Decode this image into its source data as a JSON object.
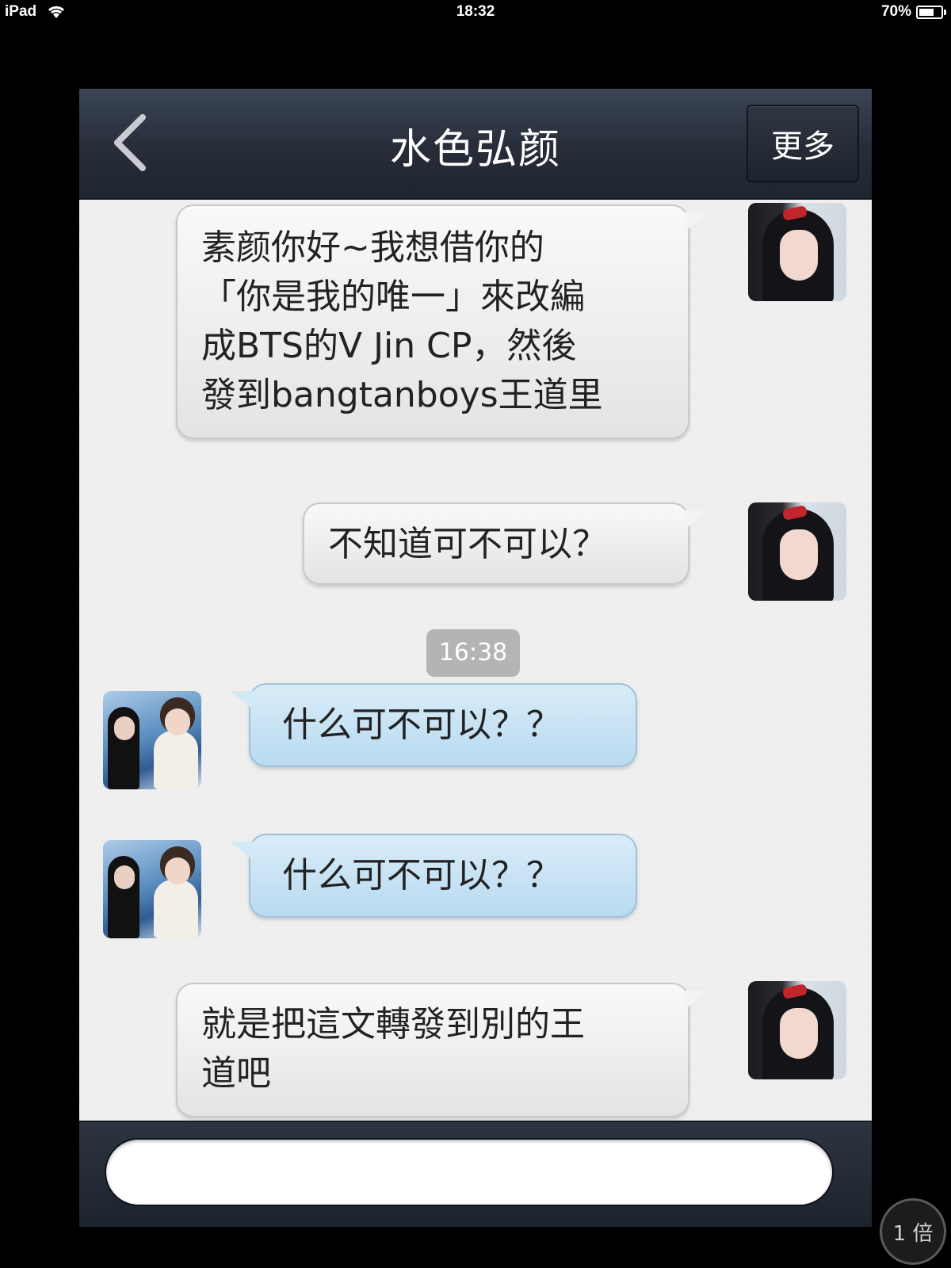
{
  "status_bar": {
    "device": "iPad",
    "time": "18:32",
    "battery": "70%",
    "battery_level": 0.7,
    "wifi_icon": "wifi-icon",
    "battery_icon": "battery-icon"
  },
  "nav": {
    "back_icon": "chevron-left-icon",
    "title": "水色弘颜",
    "more_label": "更多"
  },
  "messages": [
    {
      "side": "right",
      "avatar": "avatar-girl",
      "text": "素颜你好~我想借你的\n「你是我的唯一」來改編\n成BTS的V Jin CP，然後\n發到bangtanboys王道里"
    },
    {
      "side": "right",
      "avatar": "avatar-girl",
      "text": "不知道可不可以？"
    },
    {
      "side": "left",
      "avatar": "avatar-stage",
      "text": "什么可不可以？？"
    },
    {
      "side": "left",
      "avatar": "avatar-stage",
      "text": "什么可不可以？？"
    },
    {
      "side": "right",
      "avatar": "avatar-girl",
      "text": "就是把這文轉發到別的王\n道吧"
    }
  ],
  "timestamp": "16:38",
  "input": {
    "value": "",
    "placeholder": ""
  },
  "zoom_label": "1 倍",
  "colors": {
    "nav_bg": "#262d39",
    "chat_bg": "#efefef",
    "left_bubble": "#c6e2f5",
    "right_bubble": "#f0f0f0",
    "timestamp_bg": "#b4b4b4"
  }
}
